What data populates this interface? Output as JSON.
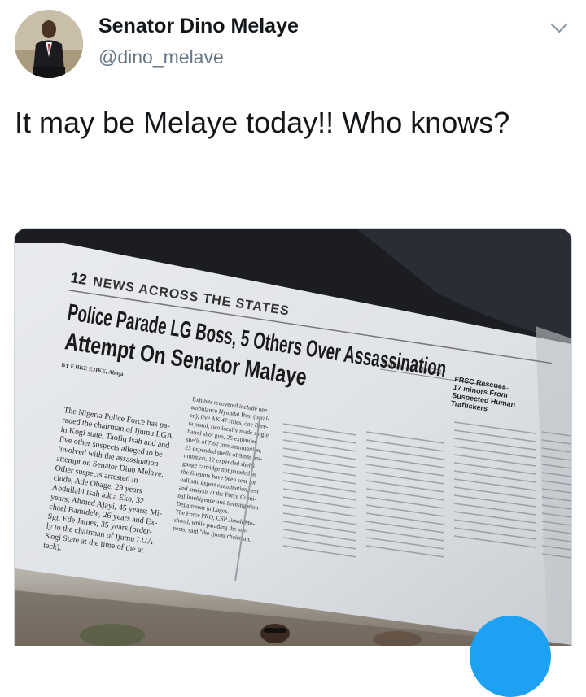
{
  "tweet": {
    "author": {
      "display_name": "Senator Dino Melaye",
      "handle": "@dino_melave",
      "avatar_icon": "profile-photo-man-in-suit"
    },
    "text": "It may be Melaye today!! Who knows?",
    "menu_icon": "chevron-down-icon"
  },
  "photo": {
    "page_number": "12",
    "section_title": "NEWS ACROSS THE STATES",
    "date_line": "Sunday, April 30, 2017",
    "headline_line1": "Police Parade LG Boss, 5 Others Over Assassination",
    "headline_line2": "Attempt On Senator Malaye",
    "byline": "BY EJIKE EJIKE, Abuja",
    "sidebar_headline": [
      "FRSC Rescues",
      "17 minors From",
      "Suspected Human",
      "Traffickers"
    ],
    "body_col1": [
      "The Nigeria Police Force has pa-",
      "raded the chairman of Ijumu LGA",
      "in Kogi state, Taofiq Isah and and",
      "five other suspects alleged to be",
      "involved with the assassination",
      "attempt on Senator Dino Melaye.",
      "Other suspects arrested in-",
      "clude, Ade Obage, 29 years",
      "Abdullahi Isah a.k.a Eko, 32",
      "years; Ahmed Ajayi, 45 years; Mi-",
      "chael Bamidele, 26 years and Ex-",
      "Sgt. Ede James, 35 years (order-",
      "ly to the chairman of Ijumu LGA",
      "Kogi State at the time of the at-",
      "tack)."
    ],
    "body_col2": [
      "Exhibits recovered include one",
      "ambulance Hyundai Bus, (paral-",
      "ed), five AK 47 rifles, one Bere-",
      "ta pistol, two locally made single",
      "barrel shot gun, 25 expended",
      "shells of 7.62 mm ammunition,",
      "23 expended shells of 9mm am-",
      "munition, 12 expended shells",
      "gauge cartridge not paraded as",
      "the firearms have been sent for",
      "ballistic expert examination, test",
      "and analysis at the Force Crimi-",
      "nal Intelligence and Investigation",
      "Department in Lagos.",
      "The Force PRO, CSP Jimoh Mo-",
      "shood, while parading the sus-",
      "pects, said \"the Ijumu chairman,"
    ]
  }
}
